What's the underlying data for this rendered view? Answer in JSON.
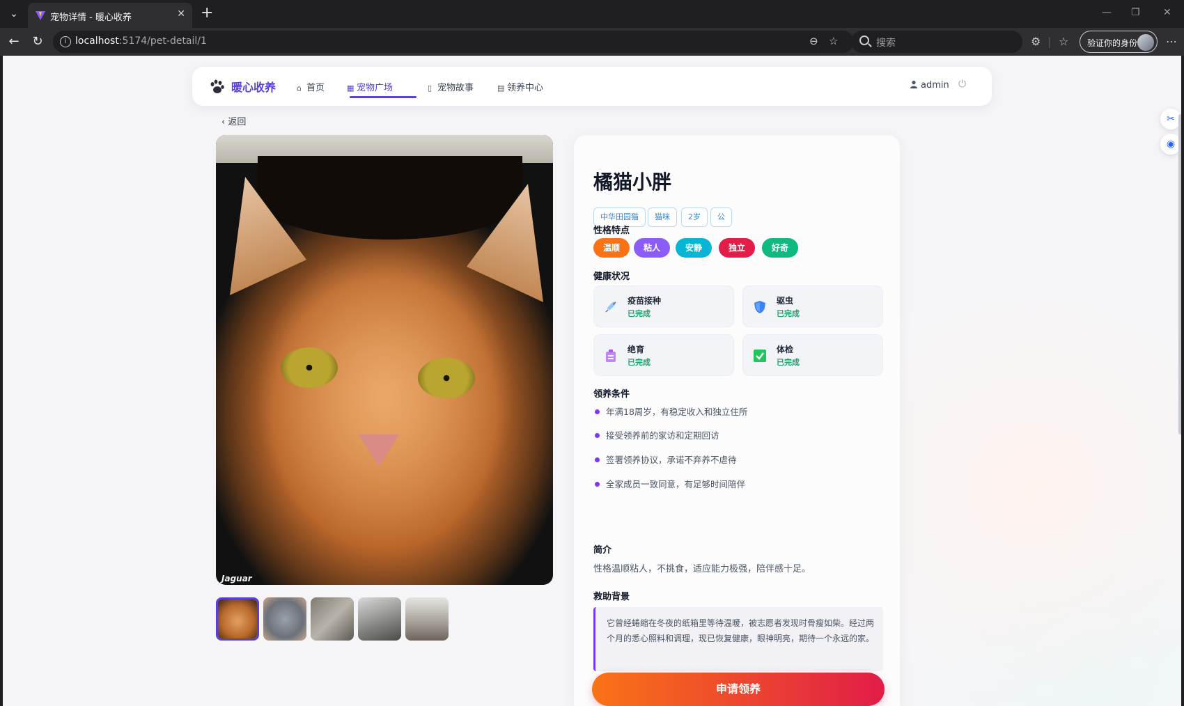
{
  "browser": {
    "tab_title": "宠物详情 - 暖心收养",
    "url_host": "localhost",
    "url_path": ":5174/pet-detail/1",
    "search_placeholder": "搜索",
    "profile_label": "验证你的身份"
  },
  "nav": {
    "brand": "暖心收养",
    "items": [
      {
        "label": "首页",
        "icon": "home-icon"
      },
      {
        "label": "宠物广场",
        "icon": "grid-icon"
      },
      {
        "label": "宠物故事",
        "icon": "book-icon"
      },
      {
        "label": "领养中心",
        "icon": "clipboard-icon"
      }
    ],
    "active_index": 1,
    "user": "admin"
  },
  "back_label": "返回",
  "gallery": {
    "photo_caption": "Jaguar",
    "thumbnail_count": 5,
    "active_thumbnail": 0
  },
  "pet": {
    "name": "橘猫小胖",
    "tags": [
      "中华田园猫",
      "猫咪",
      "2岁",
      "公"
    ],
    "personality_title": "性格特点",
    "traits": [
      {
        "label": "温顺",
        "color": "#f97316"
      },
      {
        "label": "粘人",
        "color": "#8b5cf6"
      },
      {
        "label": "安静",
        "color": "#06b6d4"
      },
      {
        "label": "独立",
        "color": "#e11d48"
      },
      {
        "label": "好奇",
        "color": "#10b981"
      }
    ],
    "health_title": "健康状况",
    "health": [
      {
        "name": "疫苗接种",
        "status": "已完成",
        "icon": "syringe-icon"
      },
      {
        "name": "驱虫",
        "status": "已完成",
        "icon": "shield-icon"
      },
      {
        "name": "绝育",
        "status": "已完成",
        "icon": "medical-kit-icon"
      },
      {
        "name": "体检",
        "status": "已完成",
        "icon": "check-box-icon"
      }
    ],
    "requirements_title": "领养条件",
    "requirements": [
      "年满18周岁，有稳定收入和独立住所",
      "接受领养前的家访和定期回访",
      "签署领养协议，承诺不弃养不虐待",
      "全家成员一致同意，有足够时间陪伴"
    ],
    "intro_title": "简介",
    "intro": "性格温顺粘人，不挑食，适应能力极强，陪伴感十足。",
    "rescue_title": "救助背景",
    "rescue": "它曾经蜷缩在冬夜的纸箱里等待温暖，被志愿者发现时骨瘦如柴。经过两个月的悉心照料和调理，现已恢复健康，眼神明亮，期待一个永远的家。",
    "apply_label": "申请领养"
  },
  "colors": {
    "brand": "#5b3fd9",
    "status_done": "#22a06b",
    "apply_gradient_start": "#f97316",
    "apply_gradient_end": "#e11d48"
  }
}
